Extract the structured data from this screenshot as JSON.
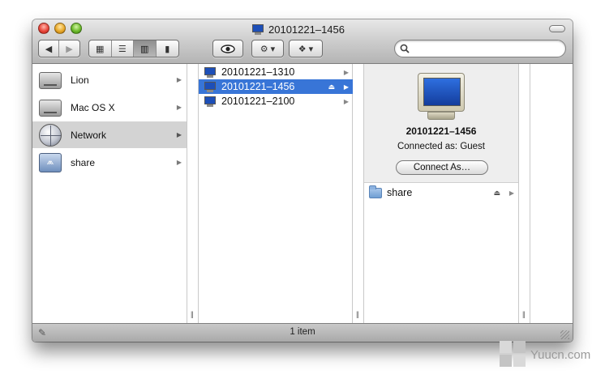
{
  "window": {
    "title": "20101221–1456"
  },
  "toolbar": {
    "back_label": "◀",
    "forward_label": "▶",
    "view_icons_label": "▦",
    "view_list_label": "☰",
    "view_columns_label": "▥",
    "view_coverflow_label": "▮",
    "quicklook_label": "👁",
    "action_label": "⚙ ▾",
    "dropbox_label": "❖ ▾",
    "search_value": "",
    "search_placeholder": ""
  },
  "sidebar": {
    "items": [
      {
        "label": "Lion",
        "icon": "hard-disk-icon"
      },
      {
        "label": "Mac OS X",
        "icon": "hard-disk-icon"
      },
      {
        "label": "Network",
        "icon": "network-globe-icon",
        "selected": true
      },
      {
        "label": "share",
        "icon": "shared-volume-icon"
      }
    ]
  },
  "column1": {
    "items": [
      {
        "label": "20101221–1310",
        "icon": "computer-icon"
      },
      {
        "label": "20101221–1456",
        "icon": "computer-icon",
        "selected": true
      },
      {
        "label": "20101221–2100",
        "icon": "computer-icon"
      }
    ]
  },
  "preview": {
    "name": "20101221–1456",
    "connection": "Connected as: Guest",
    "connect_button": "Connect As…",
    "shares": [
      {
        "label": "share",
        "icon": "folder-icon"
      }
    ]
  },
  "statusbar": {
    "item_count": "1 item"
  },
  "watermark": {
    "text": "Yuucn.com"
  },
  "colors": {
    "selection": "#3875d7",
    "sidebar_selection": "#d3d3d3"
  }
}
